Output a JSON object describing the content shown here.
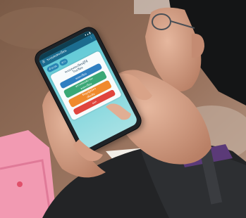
{
  "phone_app": {
    "status": {
      "time": "",
      "icons": "▾ ▴ ▮"
    },
    "app_bar": {
      "title": "ระบบลงทะเบียน",
      "menu_icon": "menu-icon"
    },
    "chips": [
      "คำนวณ",
      "ข่าว"
    ],
    "card": {
      "title": "ระบบลงทะเบียนผู้ใช้\nโรงเรียน",
      "buttons": [
        {
          "label": "ลงทะเบียน",
          "color": "#2f7fc1"
        },
        {
          "label": "ตรวจสอบสถานะ\nลงทะเบียน",
          "color": "#3aa876"
        },
        {
          "label": "ข้อมูลผู้สมัคร\nเพิ่มเติม",
          "color": "#f08a2c"
        },
        {
          "label": "ออก",
          "color": "#e0453d"
        }
      ]
    }
  },
  "palette": {
    "floor": "#8a6650",
    "pink_folder": "#f29ab2",
    "jacket": "#232426",
    "lanyard": "#5b3a78",
    "skin": "#d6a48a"
  }
}
